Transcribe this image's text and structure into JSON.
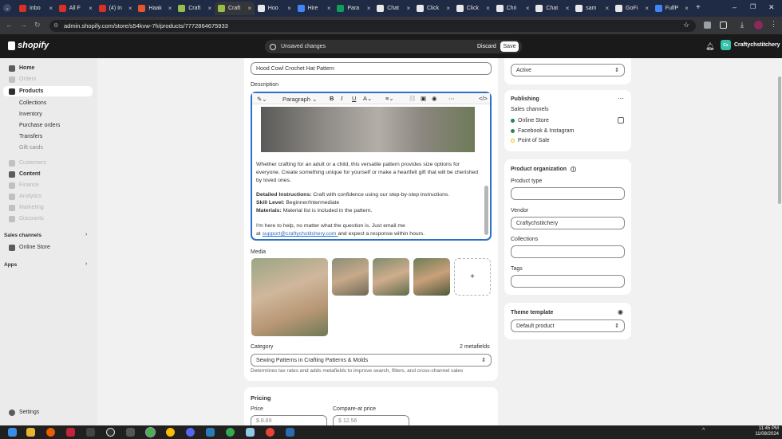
{
  "browser": {
    "tabs": [
      {
        "label": "Inbo",
        "color": "#d93025"
      },
      {
        "label": "All F",
        "color": "#d93025"
      },
      {
        "label": "(4) In",
        "color": "#d93025"
      },
      {
        "label": "Haak",
        "color": "#e8542e"
      },
      {
        "label": "Craft",
        "color": "#95bf47"
      },
      {
        "label": "Craft",
        "color": "#95bf47"
      },
      {
        "label": "Hoo",
        "color": "#e8e8e8"
      },
      {
        "label": "Hire",
        "color": "#4285f4"
      },
      {
        "label": "Para",
        "color": "#0f9d58"
      },
      {
        "label": "Chat",
        "color": "#e8e8e8"
      },
      {
        "label": "Click",
        "color": "#e8e8e8"
      },
      {
        "label": "Click",
        "color": "#e8e8e8"
      },
      {
        "label": "Chri",
        "color": "#e8e8e8"
      },
      {
        "label": "Chat",
        "color": "#e8e8e8"
      },
      {
        "label": "sam",
        "color": "#e8e8e8"
      },
      {
        "label": "GoFi",
        "color": "#e8e8e8"
      },
      {
        "label": "FulfP",
        "color": "#4285f4"
      }
    ],
    "url": "admin.shopify.com/store/s54kvw-7h/products/7772864675933"
  },
  "header": {
    "logo_text": "shopify",
    "unsaved_text": "Unsaved changes",
    "discard_label": "Discard",
    "save_label": "Save",
    "store_name": "Craftychstitchery",
    "avatar_initials": "Cs"
  },
  "sidebar": {
    "items": [
      {
        "label": "Home",
        "state": "bold"
      },
      {
        "label": "Orders",
        "state": "dim"
      },
      {
        "label": "Products",
        "state": "selected"
      },
      {
        "label": "Collections",
        "state": "sub"
      },
      {
        "label": "Inventory",
        "state": "sub"
      },
      {
        "label": "Purchase orders",
        "state": "sub"
      },
      {
        "label": "Transfers",
        "state": "sub"
      },
      {
        "label": "Gift cards",
        "state": "subdim"
      },
      {
        "label": "Customers",
        "state": "dim"
      },
      {
        "label": "Content",
        "state": "bold"
      },
      {
        "label": "Finance",
        "state": "dim"
      },
      {
        "label": "Analytics",
        "state": "dim"
      },
      {
        "label": "Marketing",
        "state": "dim"
      },
      {
        "label": "Discounts",
        "state": "dim"
      }
    ],
    "sales_channels_label": "Sales channels",
    "online_store_label": "Online Store",
    "apps_label": "Apps",
    "settings_label": "Settings"
  },
  "product": {
    "title_value": "Hood Cowl Crochet Hat Pattern",
    "description_label": "Description",
    "toolbar": {
      "format_label": "Paragraph"
    },
    "desc_para1": "Whether crafting for an adult or a child, this versatile pattern provides size options for everyone. Create something unique for yourself or make a heartfelt gift that will be cherished by loved ones.",
    "detailed_label": "Detailed Instructions:",
    "detailed_text": " Craft with confidence using our step-by-step instructions.",
    "skill_label": "Skill Level:",
    "skill_text": " Beginner/Intermediate",
    "materials_label": "Materials:",
    "materials_text": " Material list is included in the pattern.",
    "help_text1": "I'm here to help, no matter what the question is. Just email me",
    "help_text2_prefix": "at ",
    "help_email": "support@craftychstitchery.com ",
    "help_text2_suffix": " and expect a response within hours.",
    "media_label": "Media",
    "add_media_label": "+",
    "category_label": "Category",
    "metafields_label": "2 metafields",
    "category_value": "Sewing Patterns in Crafting Patterns & Molds",
    "category_help": "Determines tax rates and adds metafields to improve search, filters, and cross-channel sales",
    "pricing_label": "Pricing",
    "price_label": "Price",
    "price_value": "$ 8.89",
    "compare_label": "Compare-at price",
    "compare_value": "$ 12.56"
  },
  "right": {
    "status_value": "Active",
    "publishing_label": "Publishing",
    "sales_channels_label": "Sales channels",
    "channels": [
      {
        "label": "Online Store",
        "color": "#29845a"
      },
      {
        "label": "Facebook & Instagram",
        "color": "#29845a"
      },
      {
        "label": "Point of Sale",
        "color": "#e0c400"
      }
    ],
    "org_label": "Product organization",
    "type_label": "Product type",
    "type_value": "",
    "vendor_label": "Vendor",
    "vendor_value": "Craftychstitchery",
    "collections_label": "Collections",
    "collections_value": "",
    "tags_label": "Tags",
    "tags_value": "",
    "theme_label": "Theme template",
    "theme_value": "Default product"
  },
  "taskbar": {
    "time": "11:45 PM",
    "date": "11/08/2024"
  }
}
